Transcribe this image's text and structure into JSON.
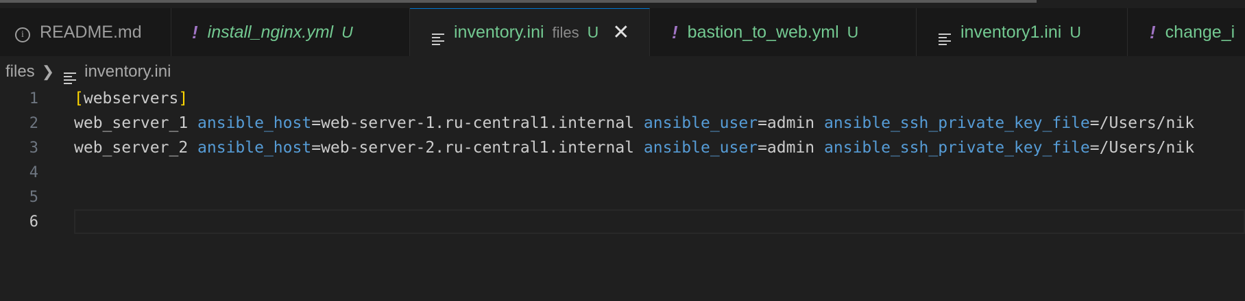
{
  "tabs": [
    {
      "label": "README.md",
      "icon": "info-icon",
      "kind": "md",
      "status": ""
    },
    {
      "label": "install_nginx.yml",
      "icon": "exclamation-icon",
      "kind": "yml",
      "status": "U"
    },
    {
      "label": "inventory.ini",
      "icon": "lines-icon",
      "kind": "ini",
      "description": "files",
      "status": "U",
      "active": true
    },
    {
      "label": "bastion_to_web.yml",
      "icon": "exclamation-icon",
      "kind": "yml",
      "status": "U"
    },
    {
      "label": "inventory1.ini",
      "icon": "lines-icon",
      "kind": "ini",
      "status": "U"
    },
    {
      "label": "change_i",
      "icon": "exclamation-icon",
      "kind": "yml",
      "status": ""
    }
  ],
  "breadcrumb": {
    "folder": "files",
    "file": "inventory.ini"
  },
  "editor": {
    "lines": [
      {
        "number": "1",
        "section": "webservers"
      },
      {
        "number": "2",
        "host": "web_server_1",
        "k1": "ansible_host",
        "v1": "web-server-1.ru-central1.internal",
        "k2": "ansible_user",
        "v2": "admin",
        "k3": "ansible_ssh_private_key_file",
        "v3": "/Users/nik"
      },
      {
        "number": "3",
        "host": "web_server_2",
        "k1": "ansible_host",
        "v1": "web-server-2.ru-central1.internal",
        "k2": "ansible_user",
        "v2": "admin",
        "k3": "ansible_ssh_private_key_file",
        "v3": "/Users/nik"
      },
      {
        "number": "4"
      },
      {
        "number": "5"
      },
      {
        "number": "6",
        "current": true
      }
    ]
  },
  "colors": {
    "modified": "#73c991",
    "key": "#569cd6",
    "bracket": "#ffd700",
    "yaml_icon": "#a074c4"
  }
}
